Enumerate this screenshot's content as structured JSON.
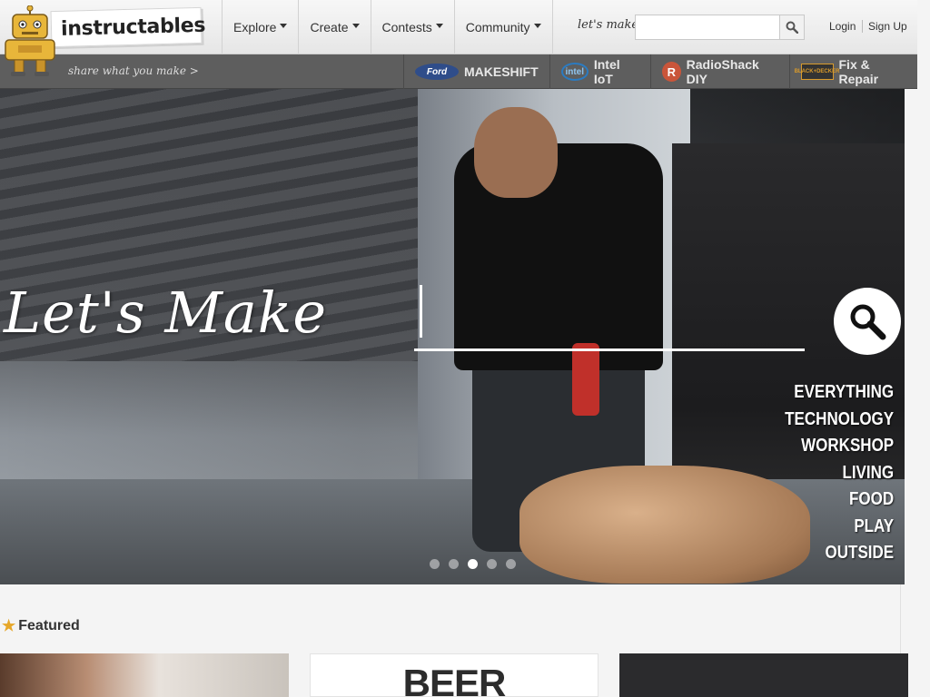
{
  "brand": {
    "name": "instructables",
    "tagline": "share what you make >"
  },
  "nav": {
    "items": [
      {
        "label": "Explore"
      },
      {
        "label": "Create"
      },
      {
        "label": "Contests"
      },
      {
        "label": "Community"
      }
    ]
  },
  "search": {
    "label": "let's make",
    "value": "",
    "placeholder": ""
  },
  "auth": {
    "login": "Login",
    "signup": "Sign Up"
  },
  "sponsors": [
    {
      "logo": "Ford",
      "label": "MAKESHIFT"
    },
    {
      "logo": "intel",
      "label": "Intel IoT"
    },
    {
      "logo": "R",
      "label": "RadioShack DIY"
    },
    {
      "logo": "BLACK+DECKER",
      "label": "Fix & Repair"
    }
  ],
  "hero": {
    "title": "Let's Make",
    "categories": [
      "EVERYTHING",
      "TECHNOLOGY",
      "WORKSHOP",
      "LIVING",
      "FOOD",
      "PLAY",
      "OUTSIDE"
    ],
    "slides": {
      "count": 5,
      "active": 3
    }
  },
  "featured": {
    "heading": "Featured",
    "cards": [
      {
        "text": ""
      },
      {
        "text": "BEER"
      },
      {
        "text": ""
      }
    ]
  },
  "colors": {
    "header_bg": "#eeeeee",
    "sponsor_bar_bg": "#5e5e5e",
    "star": "#e6a72a",
    "robot_yellow": "#e8b63a"
  }
}
